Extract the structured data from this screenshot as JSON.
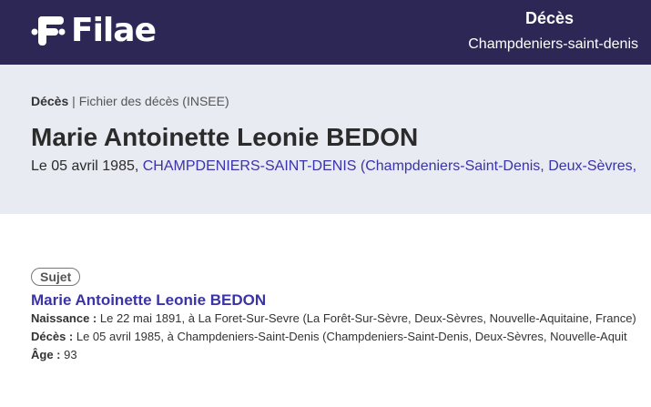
{
  "header": {
    "logo_text": "Filae",
    "title": "Décès",
    "subtitle": "Champdeniers-saint-denis"
  },
  "breadcrumb": {
    "section": "Décès",
    "separator": " | ",
    "current": "Fichier des décès (INSEE)"
  },
  "page": {
    "title": "Marie Antoinette Leonie BEDON",
    "date_prefix": "Le 05 avril 1985, ",
    "place_link": "CHAMPDENIERS-SAINT-DENIS (Champdeniers-Saint-Denis, Deux-Sèvres,"
  },
  "record": {
    "badge": "Sujet",
    "name": "Marie Antoinette Leonie BEDON",
    "birth_label": "Naissance :",
    "birth_value": " Le 22 mai 1891, à La Foret-Sur-Sevre (La Forêt-Sur-Sèvre, Deux-Sèvres, Nouvelle-Aquitaine, France)",
    "death_label": "Décès :",
    "death_value": " Le 05 avril 1985, à Champdeniers-Saint-Denis (Champdeniers-Saint-Denis, Deux-Sèvres, Nouvelle-Aquit",
    "age_label": "Âge :",
    "age_value": " 93"
  },
  "colors": {
    "header_bg": "#2d2755",
    "hero_bg": "#e8ebf2",
    "link": "#3b33a8"
  }
}
